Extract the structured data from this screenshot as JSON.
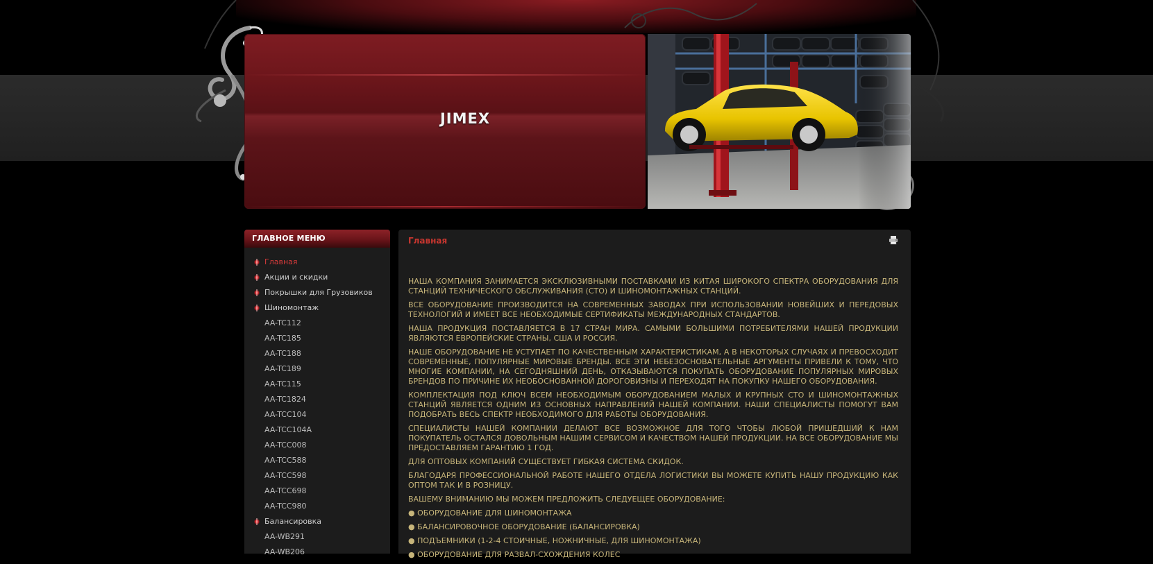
{
  "site": {
    "title": "JIMEX"
  },
  "sidebar": {
    "heading": "ГЛАВНОЕ МЕНЮ",
    "items": [
      {
        "label": "Главная",
        "level": 1,
        "active": true
      },
      {
        "label": "Акции и скидки",
        "level": 1,
        "active": false
      },
      {
        "label": "Покрышки для Грузовиков",
        "level": 1,
        "active": false
      },
      {
        "label": "Шиномонтаж",
        "level": 1,
        "active": false
      },
      {
        "label": "AA-TC112",
        "level": 2,
        "active": false
      },
      {
        "label": "AA-TC185",
        "level": 2,
        "active": false
      },
      {
        "label": "AA-TC188",
        "level": 2,
        "active": false
      },
      {
        "label": "AA-TC189",
        "level": 2,
        "active": false
      },
      {
        "label": "AA-TC115",
        "level": 2,
        "active": false
      },
      {
        "label": "AA-TC1824",
        "level": 2,
        "active": false
      },
      {
        "label": "AA-TCC104",
        "level": 2,
        "active": false
      },
      {
        "label": "AA-TCC104A",
        "level": 2,
        "active": false
      },
      {
        "label": "AA-TCC008",
        "level": 2,
        "active": false
      },
      {
        "label": "AA-TCC588",
        "level": 2,
        "active": false
      },
      {
        "label": "AA-TCC598",
        "level": 2,
        "active": false
      },
      {
        "label": "AA-TCC698",
        "level": 2,
        "active": false
      },
      {
        "label": "AA-TCC980",
        "level": 2,
        "active": false
      },
      {
        "label": "Балансировка",
        "level": 1,
        "active": false
      },
      {
        "label": "AA-WB291",
        "level": 2,
        "active": false
      },
      {
        "label": "AA-WB206",
        "level": 2,
        "active": false
      }
    ]
  },
  "content": {
    "title": "Главная",
    "print_icon": "printer-icon",
    "paragraphs": [
      "НАША КОМПАНИЯ ЗАНИМАЕТСЯ ЭКСКЛЮЗИВНЫМИ ПОСТАВКАМИ ИЗ КИТАЯ ШИРОКОГО СПЕКТРА ОБОРУДОВАНИЯ ДЛЯ СТАНЦИЙ ТЕХНИЧЕСКОГО ОБСЛУЖИВАНИЯ (СТО) И ШИНОМОНТАЖНЫХ СТАНЦИЙ.",
      "ВСЕ ОБОРУДОВАНИЕ ПРОИЗВОДИТСЯ НА СОВРЕМЕННЫХ ЗАВОДАХ ПРИ ИСПОЛЬЗОВАНИИ НОВЕЙШИХ И ПЕРЕДОВЫХ ТЕХНОЛОГИЙ И ИМЕЕТ ВСЕ НЕОБХОДИМЫЕ СЕРТИФИКАТЫ МЕЖДУНАРОДНЫХ СТАНДАРТОВ.",
      "НАША ПРОДУКЦИЯ ПОСТАВЛЯЕТСЯ В 17 СТРАН МИРА. САМЫМИ БОЛЬШИМИ ПОТРЕБИТЕЛЯМИ НАШЕЙ ПРОДУКЦИИ ЯВЛЯЮТСЯ ЕВРОПЕЙСКИЕ СТРАНЫ, США И РОССИЯ.",
      "НАШЕ ОБОРУДОВАНИЕ НЕ УСТУПАЕТ ПО КАЧЕСТВЕННЫМ ХАРАКТЕРИСТИКАМ, А В НЕКОТОРЫХ СЛУЧАЯХ И ПРЕВОСХОДИТ СОВРЕМЕННЫЕ, ПОПУЛЯРНЫЕ МИРОВЫЕ БРЕНДЫ. ВСЕ ЭТИ НЕБЕЗОСНОВАТЕЛЬНЫЕ АРГУМЕНТЫ ПРИВЕЛИ К ТОМУ, ЧТО МНОГИЕ КОМПАНИИ, НА СЕГОДНЯШНИЙ ДЕНЬ, ОТКАЗЫВАЮТСЯ ПОКУПАТЬ ОБОРУДОВАНИЕ ПОПУЛЯРНЫХ МИРОВЫХ БРЕНДОВ ПО ПРИЧИНЕ ИХ НЕОБОСНОВАННОЙ ДОРОГОВИЗНЫ И ПЕРЕХОДЯТ НА ПОКУПКУ НАШЕГО ОБОРУДОВАНИЯ.",
      "КОМПЛЕКТАЦИЯ ПОД КЛЮЧ ВСЕМ НЕОБХОДИМЫМ ОБОРУДОВАНИЕМ МАЛЫХ И КРУПНЫХ СТО И ШИНОМОНТАЖНЫХ СТАНЦИЙ ЯВЛЯЕТСЯ ОДНИМ ИЗ ОСНОВНЫХ НАПРАВЛЕНИЙ НАШЕЙ КОМПАНИИ. НАШИ СПЕЦИАЛИСТЫ ПОМОГУТ ВАМ ПОДОБРАТЬ ВЕСЬ СПЕКТР НЕОБХОДИМОГО ДЛЯ РАБОТЫ ОБОРУДОВАНИЯ.",
      "СПЕЦИАЛИСТЫ НАШЕЙ КОМПАНИИ ДЕЛАЮТ ВСЕ ВОЗМОЖНОЕ ДЛЯ ТОГО ЧТОБЫ ЛЮБОЙ ПРИШЕДШИЙ К НАМ ПОКУПАТЕЛЬ ОСТАЛСЯ ДОВОЛЬНЫМ НАШИМ СЕРВИСОМ И КАЧЕСТВОМ НАШЕЙ ПРОДУКЦИИ. НА ВСЕ ОБОРУДОВАНИЕ МЫ ПРЕДОСТАВЛЯЕМ ГАРАНТИЮ 1 ГОД.",
      "ДЛЯ ОПТОВЫХ КОМПАНИЙ СУЩЕСТВУЕТ ГИБКАЯ СИСТЕМА СКИДОК.",
      "БЛАГОДАРЯ ПРОФЕССИОНАЛЬНОЙ РАБОТЕ НАШЕГО ОТДЕЛА ЛОГИСТИКИ ВЫ МОЖЕТЕ КУПИТЬ НАШУ ПРОДУКЦИЮ КАК ОПТОМ ТАК И В РОЗНИЦУ.",
      "ВАШЕМУ ВНИМАНИЮ МЫ МОЖЕМ ПРЕДЛОЖИТЬ СЛЕДУЕЩЕЕ ОБОРУДОВАНИЕ:"
    ],
    "list_items": [
      "● ОБОРУДОВАНИЕ ДЛЯ ШИНОМОНТАЖА",
      "● БАЛАНСИРОВОЧНОЕ ОБОРУДОВАНИЕ (БАЛАНСИРОВКА)",
      "● ПОДЪЕМНИКИ (1-2-4 СТОИЧНЫЕ, НОЖНИЧНЫЕ, ДЛЯ ШИНОМОНТАЖА)",
      "● ОБОРУДОВАНИЕ ДЛЯ РАЗВАЛ-СХОЖДЕНИЯ КОЛЕС"
    ]
  },
  "colors": {
    "accent_red": "#c8362f",
    "text_gold": "#c7b57a",
    "panel_bg": "#1c1c1c",
    "page_bg": "#000000"
  }
}
